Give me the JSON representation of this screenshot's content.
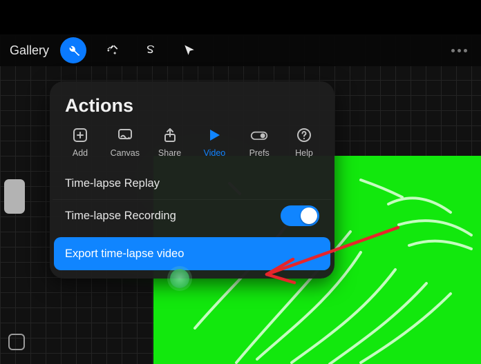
{
  "toolbar": {
    "gallery_label": "Gallery"
  },
  "actions": {
    "title": "Actions",
    "tabs": {
      "add": "Add",
      "canvas": "Canvas",
      "share": "Share",
      "video": "Video",
      "prefs": "Prefs",
      "help": "Help"
    },
    "active_tab": "Video",
    "rows": {
      "timelapse_replay": "Time-lapse Replay",
      "timelapse_recording": "Time-lapse Recording",
      "recording_enabled": true,
      "export_timelapse": "Export time-lapse video"
    }
  },
  "colors": {
    "accent": "#1085ff",
    "canvas_green": "#12e80d",
    "arrow": "#e6252b"
  }
}
